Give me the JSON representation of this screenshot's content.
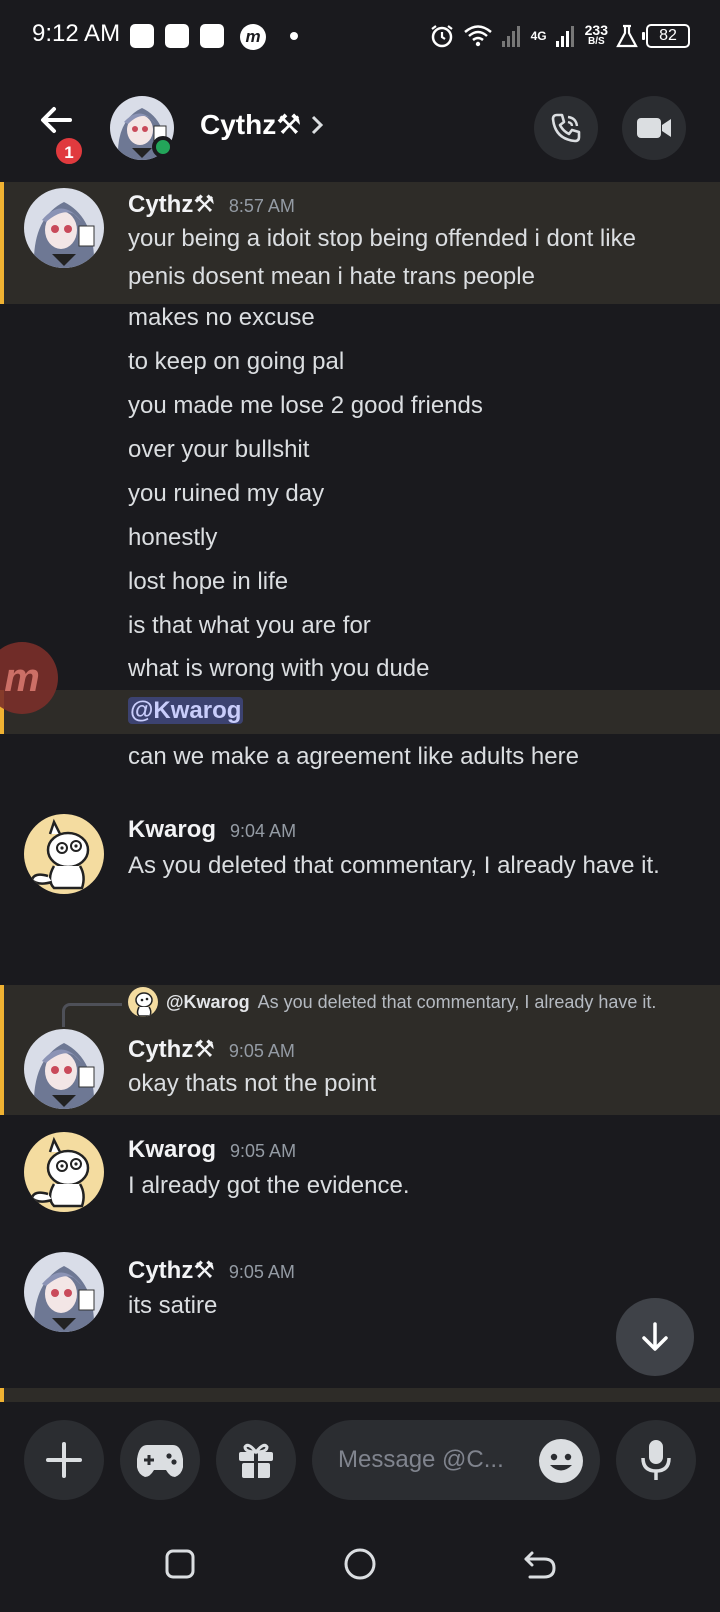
{
  "status_bar": {
    "time": "9:12 AM",
    "network": "4G",
    "speed_value": "233",
    "speed_unit": "B/S",
    "battery": "82"
  },
  "header": {
    "name": "Cythz⚒",
    "badge": "1"
  },
  "messages": [
    {
      "author": "Cythz⚒",
      "time": "8:57 AM",
      "lines": [
        "your being a idoit stop being offended i dont like penis dosent mean i hate trans people"
      ]
    },
    {
      "continuation": [
        "makes no excuse",
        "to keep on going pal",
        "you made me lose 2 good friends",
        "over your bullshit",
        "you ruined my day",
        "honestly",
        "lost hope in life",
        "is that what you are for",
        "what is wrong with you dude"
      ]
    },
    {
      "mention": "@Kwarog"
    },
    {
      "text": "can we make  a agreement like adults here"
    },
    {
      "author": "Kwarog",
      "time": "9:04 AM",
      "text": "As you deleted that commentary, I already have it."
    },
    {
      "reply_to": "@Kwarog",
      "reply_text": "As you deleted that commentary, I already have it.",
      "author": "Cythz⚒",
      "time": "9:05 AM",
      "text": "okay thats not the point"
    },
    {
      "author": "Kwarog",
      "time": "9:05 AM",
      "text": "I already got the evidence."
    },
    {
      "author": "Cythz⚒",
      "time": "9:05 AM",
      "text": "its satire"
    }
  ],
  "composer": {
    "placeholder": "Message @C..."
  },
  "colors": {
    "background": "#1a1a1e",
    "highlight": "#2e2c28",
    "highlight_bar": "#f0b232",
    "online": "#23a55a",
    "badge": "#e03a3e",
    "mention_bg": "#3c4270"
  }
}
